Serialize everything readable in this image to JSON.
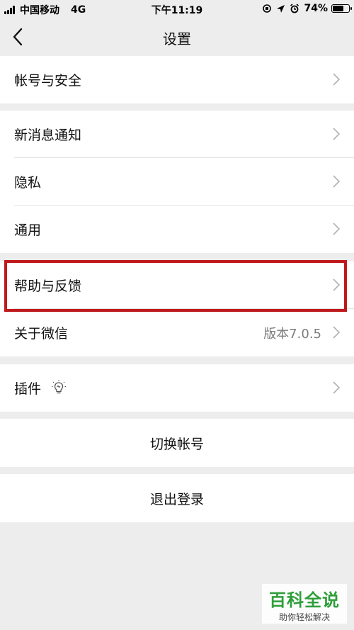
{
  "status_bar": {
    "carrier": "中国移动",
    "network": "4G",
    "time": "下午11:19",
    "battery_text": "74%",
    "battery_level": 0.74
  },
  "nav": {
    "title": "设置",
    "back_icon": "chevron-left-icon"
  },
  "groups": {
    "account": {
      "label": "帐号与安全"
    },
    "notifications": {
      "label": "新消息通知"
    },
    "privacy": {
      "label": "隐私"
    },
    "general": {
      "label": "通用"
    },
    "help": {
      "label": "帮助与反馈"
    },
    "about": {
      "label": "关于微信",
      "value": "版本7.0.5"
    },
    "plugins": {
      "label": "插件",
      "icon": "lightbulb-icon"
    }
  },
  "actions": {
    "switch_account": "切换帐号",
    "logout": "退出登录"
  },
  "watermark": {
    "main": "百科全说",
    "sub": "助你轻松解决"
  },
  "colors": {
    "background": "#ededed",
    "highlight": "#c0191c",
    "watermark_green": "#2e9e3a"
  }
}
